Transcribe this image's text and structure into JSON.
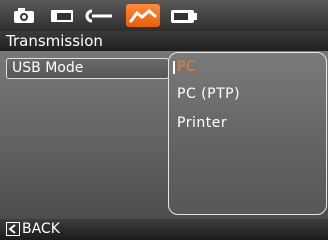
{
  "tabs": [
    {
      "icon": "camera-icon",
      "active": false
    },
    {
      "icon": "screen-icon",
      "active": false
    },
    {
      "icon": "key-icon",
      "active": false
    },
    {
      "icon": "connection-icon",
      "active": true
    },
    {
      "icon": "battery-icon",
      "active": false
    }
  ],
  "section": {
    "title": "Transmission"
  },
  "setting": {
    "label": "USB Mode"
  },
  "options": {
    "items": [
      "PC",
      "PC (PTP)",
      "Printer"
    ],
    "selected": "PC"
  },
  "footer": {
    "back_label": "BACK"
  },
  "colors": {
    "accent": "#FF7A1A",
    "highlight_tab": "#F26A1B"
  }
}
